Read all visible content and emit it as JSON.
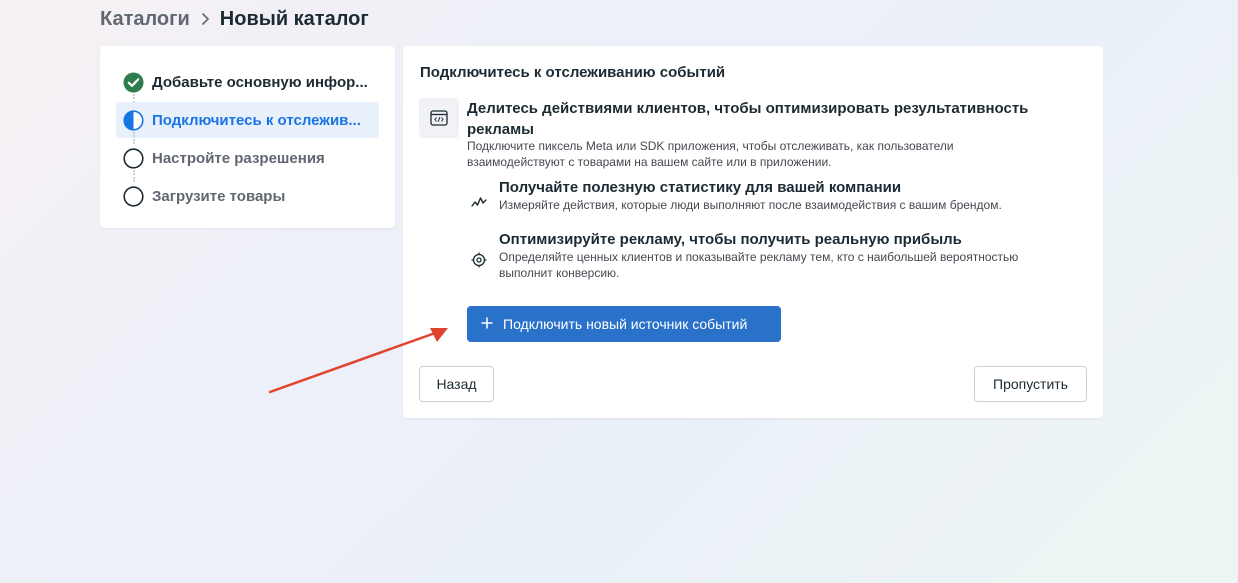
{
  "breadcrumb": {
    "parent": "Каталоги",
    "current": "Новый каталог"
  },
  "steps": [
    {
      "label": "Добавьте основную инфор...",
      "status": "done"
    },
    {
      "label": "Подключитесь к отслежив...",
      "status": "active"
    },
    {
      "label": "Настройте разрешения",
      "status": "pending"
    },
    {
      "label": "Загрузите товары",
      "status": "pending"
    }
  ],
  "main": {
    "title": "Подключитесь к отслеживанию событий",
    "feature": {
      "icon": "code-window-icon",
      "title": "Делитесь действиями клиентов, чтобы оптимизировать результативность рекламы",
      "description": "Подключите пиксель Meta или SDK приложения, чтобы отслеживать, как пользователи взаимодействуют с товарами на вашем сайте или в приложении."
    },
    "sub_items": [
      {
        "icon": "activity-line-icon",
        "title": "Получайте полезную статистику для вашей компании",
        "description": "Измеряйте действия, которые люди выполняют после взаимодействия с вашим брендом."
      },
      {
        "icon": "target-icon",
        "title": "Оптимизируйте рекламу, чтобы получить реальную прибыль",
        "description": "Определяйте ценных клиентов и показывайте рекламу тем, кто с наибольшей вероятностью выполнит конверсию."
      }
    ],
    "connect_button": "Подключить новый источник событий",
    "back_button": "Назад",
    "skip_button": "Пропустить"
  },
  "colors": {
    "accent": "#2a71c9",
    "success": "#2e7d4f",
    "annotation_arrow": "#e0442f"
  }
}
